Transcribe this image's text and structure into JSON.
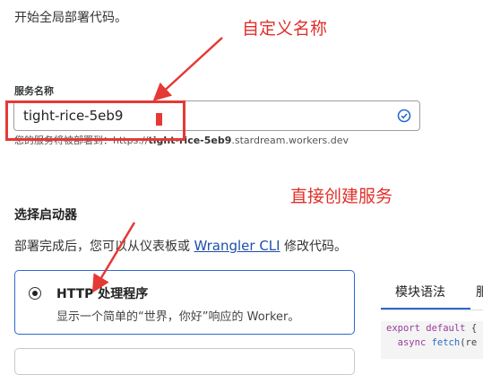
{
  "intro": "开始全局部署代码。",
  "annotations": {
    "custom_name": "自定义名称",
    "create_service": "直接创建服务"
  },
  "service_name": {
    "label": "服务名称",
    "value": "tight-rice-5eb9",
    "hint_prefix": "您的服务将被部署到：https://",
    "hint_bold": "tight-rice-5eb9",
    "hint_suffix": ".stardream.workers.dev"
  },
  "starter": {
    "title": "选择启动器",
    "desc_prefix": "部署完成后，您可以从仪表板或 ",
    "desc_link": "Wrangler CLI",
    "desc_suffix": " 修改代码。",
    "options": [
      {
        "title": "HTTP 处理程序",
        "subtitle": "显示一个简单的“世界，你好”响应的 Worker。",
        "selected": true
      }
    ]
  },
  "tabs": [
    "模块语法",
    "服"
  ],
  "code_lines": [
    "export default {",
    "  async fetch(re"
  ],
  "colors": {
    "annotation": "#e53935",
    "accent": "#2c6ad1"
  }
}
